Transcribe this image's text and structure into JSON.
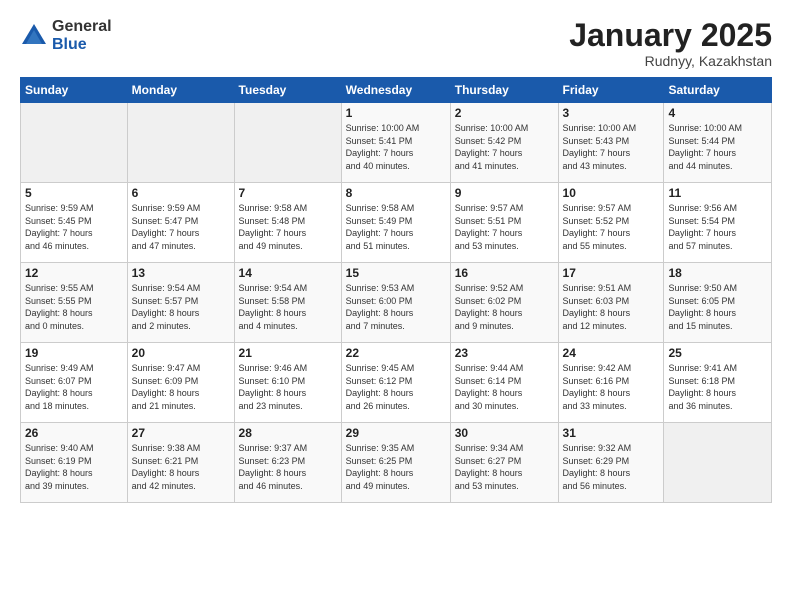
{
  "logo": {
    "general": "General",
    "blue": "Blue"
  },
  "title": {
    "month": "January 2025",
    "location": "Rudnyy, Kazakhstan"
  },
  "days_header": [
    "Sunday",
    "Monday",
    "Tuesday",
    "Wednesday",
    "Thursday",
    "Friday",
    "Saturday"
  ],
  "weeks": [
    [
      {
        "day": "",
        "info": ""
      },
      {
        "day": "",
        "info": ""
      },
      {
        "day": "",
        "info": ""
      },
      {
        "day": "1",
        "info": "Sunrise: 10:00 AM\nSunset: 5:41 PM\nDaylight: 7 hours\nand 40 minutes."
      },
      {
        "day": "2",
        "info": "Sunrise: 10:00 AM\nSunset: 5:42 PM\nDaylight: 7 hours\nand 41 minutes."
      },
      {
        "day": "3",
        "info": "Sunrise: 10:00 AM\nSunset: 5:43 PM\nDaylight: 7 hours\nand 43 minutes."
      },
      {
        "day": "4",
        "info": "Sunrise: 10:00 AM\nSunset: 5:44 PM\nDaylight: 7 hours\nand 44 minutes."
      }
    ],
    [
      {
        "day": "5",
        "info": "Sunrise: 9:59 AM\nSunset: 5:45 PM\nDaylight: 7 hours\nand 46 minutes."
      },
      {
        "day": "6",
        "info": "Sunrise: 9:59 AM\nSunset: 5:47 PM\nDaylight: 7 hours\nand 47 minutes."
      },
      {
        "day": "7",
        "info": "Sunrise: 9:58 AM\nSunset: 5:48 PM\nDaylight: 7 hours\nand 49 minutes."
      },
      {
        "day": "8",
        "info": "Sunrise: 9:58 AM\nSunset: 5:49 PM\nDaylight: 7 hours\nand 51 minutes."
      },
      {
        "day": "9",
        "info": "Sunrise: 9:57 AM\nSunset: 5:51 PM\nDaylight: 7 hours\nand 53 minutes."
      },
      {
        "day": "10",
        "info": "Sunrise: 9:57 AM\nSunset: 5:52 PM\nDaylight: 7 hours\nand 55 minutes."
      },
      {
        "day": "11",
        "info": "Sunrise: 9:56 AM\nSunset: 5:54 PM\nDaylight: 7 hours\nand 57 minutes."
      }
    ],
    [
      {
        "day": "12",
        "info": "Sunrise: 9:55 AM\nSunset: 5:55 PM\nDaylight: 8 hours\nand 0 minutes."
      },
      {
        "day": "13",
        "info": "Sunrise: 9:54 AM\nSunset: 5:57 PM\nDaylight: 8 hours\nand 2 minutes."
      },
      {
        "day": "14",
        "info": "Sunrise: 9:54 AM\nSunset: 5:58 PM\nDaylight: 8 hours\nand 4 minutes."
      },
      {
        "day": "15",
        "info": "Sunrise: 9:53 AM\nSunset: 6:00 PM\nDaylight: 8 hours\nand 7 minutes."
      },
      {
        "day": "16",
        "info": "Sunrise: 9:52 AM\nSunset: 6:02 PM\nDaylight: 8 hours\nand 9 minutes."
      },
      {
        "day": "17",
        "info": "Sunrise: 9:51 AM\nSunset: 6:03 PM\nDaylight: 8 hours\nand 12 minutes."
      },
      {
        "day": "18",
        "info": "Sunrise: 9:50 AM\nSunset: 6:05 PM\nDaylight: 8 hours\nand 15 minutes."
      }
    ],
    [
      {
        "day": "19",
        "info": "Sunrise: 9:49 AM\nSunset: 6:07 PM\nDaylight: 8 hours\nand 18 minutes."
      },
      {
        "day": "20",
        "info": "Sunrise: 9:47 AM\nSunset: 6:09 PM\nDaylight: 8 hours\nand 21 minutes."
      },
      {
        "day": "21",
        "info": "Sunrise: 9:46 AM\nSunset: 6:10 PM\nDaylight: 8 hours\nand 23 minutes."
      },
      {
        "day": "22",
        "info": "Sunrise: 9:45 AM\nSunset: 6:12 PM\nDaylight: 8 hours\nand 26 minutes."
      },
      {
        "day": "23",
        "info": "Sunrise: 9:44 AM\nSunset: 6:14 PM\nDaylight: 8 hours\nand 30 minutes."
      },
      {
        "day": "24",
        "info": "Sunrise: 9:42 AM\nSunset: 6:16 PM\nDaylight: 8 hours\nand 33 minutes."
      },
      {
        "day": "25",
        "info": "Sunrise: 9:41 AM\nSunset: 6:18 PM\nDaylight: 8 hours\nand 36 minutes."
      }
    ],
    [
      {
        "day": "26",
        "info": "Sunrise: 9:40 AM\nSunset: 6:19 PM\nDaylight: 8 hours\nand 39 minutes."
      },
      {
        "day": "27",
        "info": "Sunrise: 9:38 AM\nSunset: 6:21 PM\nDaylight: 8 hours\nand 42 minutes."
      },
      {
        "day": "28",
        "info": "Sunrise: 9:37 AM\nSunset: 6:23 PM\nDaylight: 8 hours\nand 46 minutes."
      },
      {
        "day": "29",
        "info": "Sunrise: 9:35 AM\nSunset: 6:25 PM\nDaylight: 8 hours\nand 49 minutes."
      },
      {
        "day": "30",
        "info": "Sunrise: 9:34 AM\nSunset: 6:27 PM\nDaylight: 8 hours\nand 53 minutes."
      },
      {
        "day": "31",
        "info": "Sunrise: 9:32 AM\nSunset: 6:29 PM\nDaylight: 8 hours\nand 56 minutes."
      },
      {
        "day": "",
        "info": ""
      }
    ]
  ]
}
